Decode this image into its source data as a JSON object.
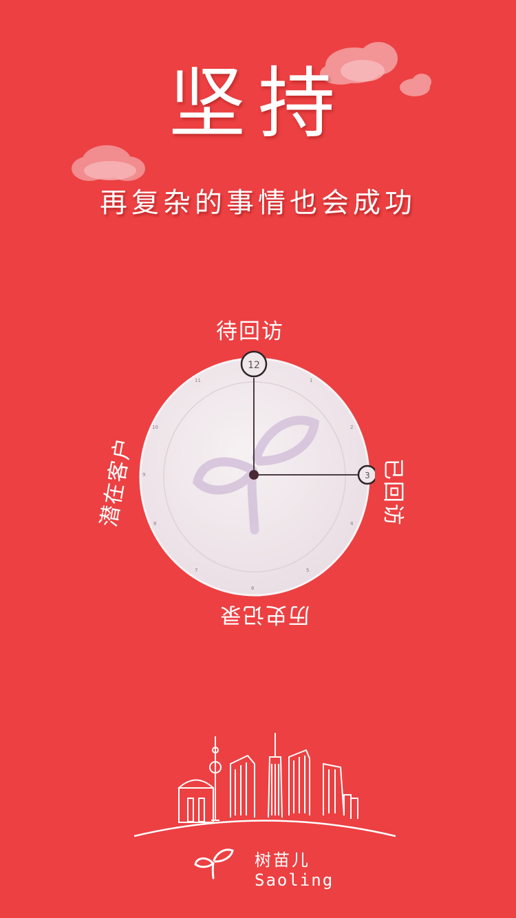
{
  "header": {
    "title": "坚持",
    "subtitle": "再复杂的事情也会成功"
  },
  "clock": {
    "hour_markers": [
      "12",
      "1",
      "2",
      "3",
      "4",
      "5",
      "6",
      "7",
      "8",
      "9",
      "10",
      "11"
    ],
    "hour_hand_points_to": "3",
    "minute_hand_points_to": "12",
    "labels": {
      "top": "待回访",
      "right": "已回访",
      "bottom": "历史记录",
      "left": "潜在客户"
    }
  },
  "brand": {
    "name": "树苗儿",
    "name_en": "Saoling"
  },
  "colors": {
    "background": "#ec4042",
    "clock_face": "#f1e8ec",
    "logo_watermark": "#d6c3dc",
    "text": "#ffffff"
  }
}
